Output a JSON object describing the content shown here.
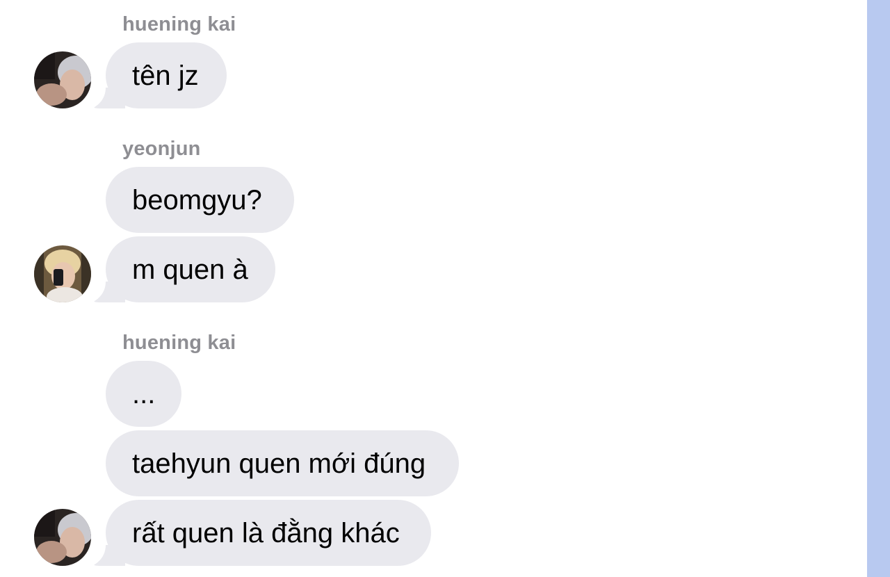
{
  "colors": {
    "bubble": "#e9e9ee",
    "sender_name": "#8e8e93",
    "message_text": "#000000",
    "side_strip": "#b8c9f0",
    "background": "#ffffff"
  },
  "groups": [
    {
      "sender": "huening kai",
      "avatar": "huening-kai-avatar",
      "messages": [
        "tên jz"
      ]
    },
    {
      "sender": "yeonjun",
      "avatar": "yeonjun-avatar",
      "messages": [
        "beomgyu?",
        "m quen à"
      ]
    },
    {
      "sender": "huening kai",
      "avatar": "huening-kai-avatar",
      "messages": [
        "...",
        "taehyun quen mới đúng",
        "rất quen là đằng khác"
      ]
    }
  ]
}
